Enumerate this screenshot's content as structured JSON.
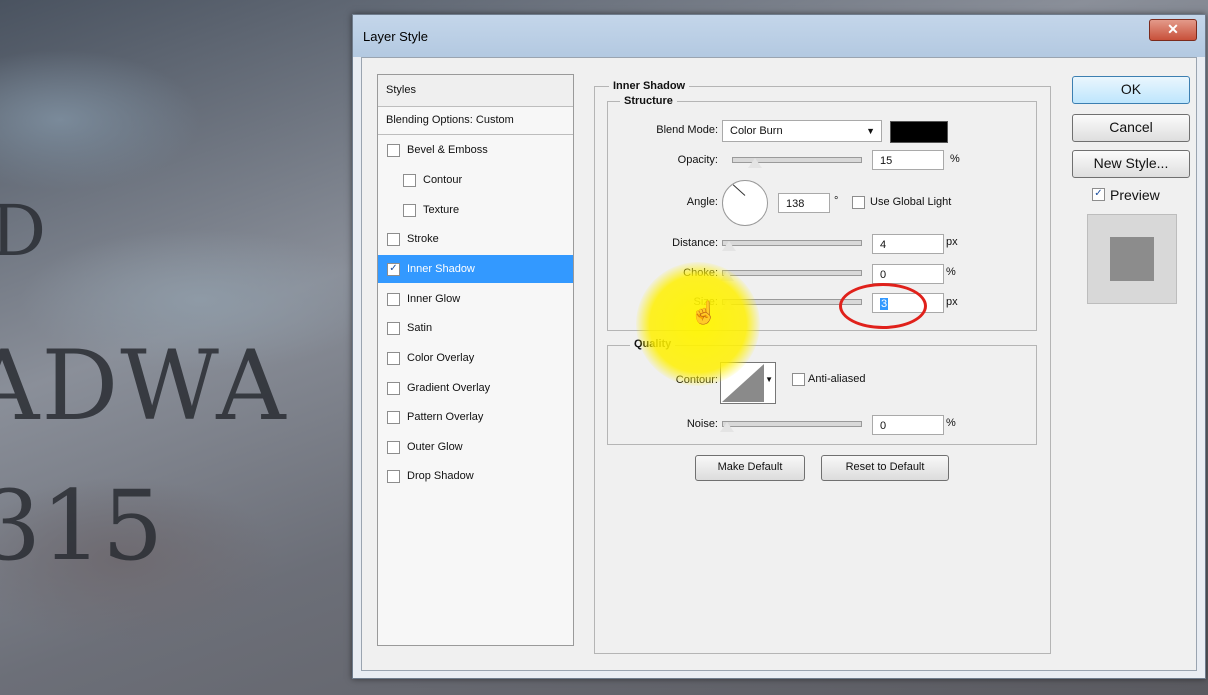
{
  "background": {
    "text_line1": "ADWA",
    "text_line2": "315",
    "text_side": "D"
  },
  "window": {
    "title": "Layer Style",
    "close_glyph": "✕"
  },
  "styles_panel": {
    "header": "Styles",
    "blending": "Blending Options: Custom",
    "items": [
      {
        "label": "Bevel & Emboss",
        "checked": false
      },
      {
        "label": "Contour",
        "checked": false
      },
      {
        "label": "Texture",
        "checked": false
      },
      {
        "label": "Stroke",
        "checked": false
      },
      {
        "label": "Inner Shadow",
        "checked": true
      },
      {
        "label": "Inner Glow",
        "checked": false
      },
      {
        "label": "Satin",
        "checked": false
      },
      {
        "label": "Color Overlay",
        "checked": false
      },
      {
        "label": "Gradient Overlay",
        "checked": false
      },
      {
        "label": "Pattern Overlay",
        "checked": false
      },
      {
        "label": "Outer Glow",
        "checked": false
      },
      {
        "label": "Drop Shadow",
        "checked": false
      }
    ]
  },
  "inner_shadow": {
    "section_title": "Inner Shadow",
    "structure_title": "Structure",
    "blend_mode_label": "Blend Mode:",
    "blend_mode_value": "Color Burn",
    "blend_color": "#000000",
    "opacity_label": "Opacity:",
    "opacity_value": "15",
    "opacity_unit": "%",
    "angle_label": "Angle:",
    "angle_value": "138",
    "angle_unit": "°",
    "global_light_label": "Use Global Light",
    "distance_label": "Distance:",
    "distance_value": "4",
    "distance_unit": "px",
    "choke_label": "Choke:",
    "choke_value": "0",
    "choke_unit": "%",
    "size_label": "Size:",
    "size_value": "3",
    "size_unit": "px"
  },
  "quality": {
    "title": "Quality",
    "contour_label": "Contour:",
    "anti_aliased_label": "Anti-aliased",
    "noise_label": "Noise:",
    "noise_value": "0",
    "noise_unit": "%"
  },
  "buttons": {
    "make_default": "Make Default",
    "reset_default": "Reset to Default",
    "ok": "OK",
    "cancel": "Cancel",
    "new_style": "New Style...",
    "preview_label": "Preview"
  },
  "colors": {
    "selection": "#3399ff",
    "highlight": "#ffee00",
    "annotation": "#e0211b"
  }
}
